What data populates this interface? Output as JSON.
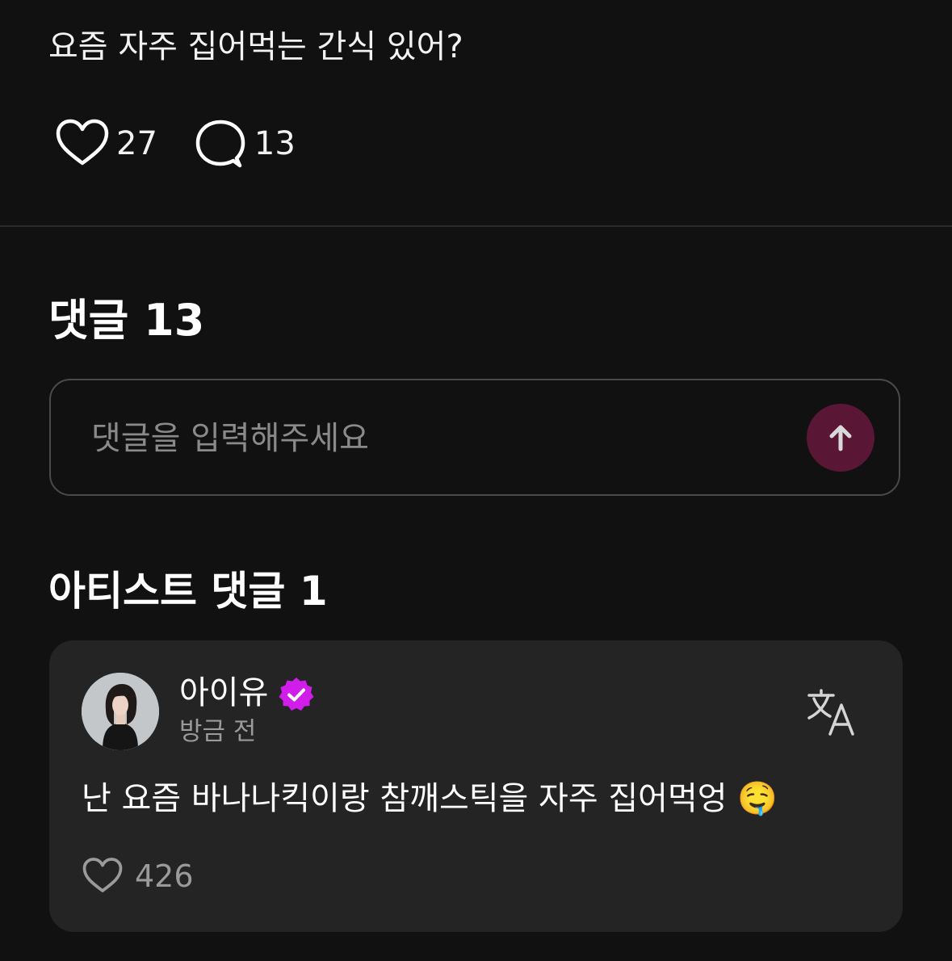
{
  "post": {
    "text": "요즘 자주 집어먹는 간식 있어?",
    "likes": "27",
    "comments": "13"
  },
  "comments_section": {
    "title": "댓글 13",
    "input_placeholder": "댓글을 입력해주세요"
  },
  "artist_section": {
    "title": "아티스트 댓글 1",
    "comment": {
      "author": "아이유",
      "time": "방금 전",
      "text": "난 요즘 바나나킥이랑 참깨스틱을 자주 집어먹엉 🤤",
      "likes": "426"
    }
  },
  "icons": {
    "like": "heart-icon",
    "comment": "speech-bubble-icon",
    "send": "arrow-up-icon",
    "verified": "verified-badge-icon",
    "translate": "translate-icon"
  },
  "colors": {
    "background": "#111111",
    "card": "#242424",
    "send_button": "#5a1635",
    "verified": "#d01dea"
  }
}
